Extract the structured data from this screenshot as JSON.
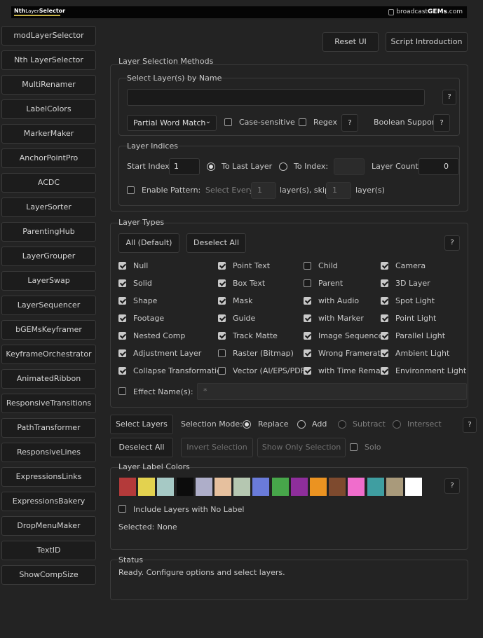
{
  "header": {
    "logo_main": "Nth",
    "logo_layer": "Layer",
    "logo_sel": "Selector",
    "brand_pre": "broadcast",
    "brand_gems": "GEMs",
    "brand_post": ".com"
  },
  "sidebar": {
    "items": [
      "modLayerSelector",
      "Nth LayerSelector",
      "MultiRenamer",
      "LabelColors",
      "MarkerMaker",
      "AnchorPointPro",
      "ACDC",
      "LayerSorter",
      "ParentingHub",
      "LayerGrouper",
      "LayerSwap",
      "LayerSequencer",
      "bGEMsKeyframer",
      "KeyframeOrchestrator",
      "AnimatedRibbon",
      "ResponsiveTransitions",
      "PathTransformer",
      "ResponsiveLines",
      "ExpressionsLinks",
      "ExpressionsBakery",
      "DropMenuMaker",
      "TextID",
      "ShowCompSize"
    ]
  },
  "top": {
    "reset": "Reset UI",
    "intro": "Script Introduction"
  },
  "methods": {
    "title": "Layer Selection Methods",
    "by_name": {
      "title": "Select Layer(s) by Name",
      "value": "",
      "match": "Partial Word Match",
      "case": "Case-sensitive",
      "regex": "Regex",
      "bool": "Boolean Support",
      "help": "?"
    },
    "indices": {
      "title": "Layer Indices",
      "start_label": "Start Index:",
      "start_value": "1",
      "to_last": "To Last Layer",
      "to_index": "To Index:",
      "count_label": "Layer Count:",
      "count_value": "0",
      "pattern": "Enable Pattern:",
      "every": "Select Every",
      "every_val": "1",
      "skip_label": "layer(s), skip",
      "skip_val": "1",
      "tail": "layer(s)"
    }
  },
  "types": {
    "title": "Layer Types",
    "all": "All (Default)",
    "deselect": "Deselect All",
    "help": "?",
    "col1": [
      {
        "label": "Null",
        "checked": true
      },
      {
        "label": "Solid",
        "checked": true
      },
      {
        "label": "Shape",
        "checked": true
      },
      {
        "label": "Footage",
        "checked": true
      },
      {
        "label": "Nested Comp",
        "checked": true
      },
      {
        "label": "Adjustment Layer",
        "checked": true
      },
      {
        "label": "Collapse Transformation",
        "checked": true
      }
    ],
    "col2": [
      {
        "label": "Point Text",
        "checked": true
      },
      {
        "label": "Box Text",
        "checked": true
      },
      {
        "label": "Mask",
        "checked": true
      },
      {
        "label": "Guide",
        "checked": true
      },
      {
        "label": "Track Matte",
        "checked": true
      },
      {
        "label": "Raster (Bitmap)",
        "checked": false
      },
      {
        "label": "Vector (AI/EPS/PDF)",
        "checked": false
      }
    ],
    "col3": [
      {
        "label": "Child",
        "checked": false
      },
      {
        "label": "Parent",
        "checked": false
      },
      {
        "label": "with Audio",
        "checked": true
      },
      {
        "label": "with Marker",
        "checked": true
      },
      {
        "label": "Image Sequence",
        "checked": true
      },
      {
        "label": "Wrong Framerate",
        "checked": true
      },
      {
        "label": "with Time Remap",
        "checked": true
      }
    ],
    "col4": [
      {
        "label": "Camera",
        "checked": true
      },
      {
        "label": "3D Layer",
        "checked": true
      },
      {
        "label": "Spot Light",
        "checked": true
      },
      {
        "label": "Point Light",
        "checked": true
      },
      {
        "label": "Parallel Light",
        "checked": true
      },
      {
        "label": "Ambient Light",
        "checked": true
      },
      {
        "label": "Environment Light",
        "checked": true
      }
    ],
    "effect_label": "Effect Name(s):",
    "effect_placeholder": "*"
  },
  "actions": {
    "select": "Select Layers",
    "mode_label": "Selection Mode:",
    "replace": "Replace",
    "add": "Add",
    "subtract": "Subtract",
    "intersect": "Intersect",
    "deselect": "Deselect All",
    "invert": "Invert Selection",
    "show_only": "Show Only Selection",
    "solo": "Solo",
    "help": "?"
  },
  "labels": {
    "title": "Layer Label Colors",
    "colors": [
      "#b43a3a",
      "#e3d24f",
      "#a6c9c5",
      "#0c0c0c",
      "#aeaec9",
      "#e6c09e",
      "#b5c7b1",
      "#6a7bd9",
      "#47a64a",
      "#8e2e9b",
      "#eb9321",
      "#7e4a2e",
      "#f06dcc",
      "#3f9ea1",
      "#a99a7b",
      "#ffffff"
    ],
    "include": "Include Layers with No Label",
    "selected": "Selected: None",
    "help": "?"
  },
  "status": {
    "title": "Status",
    "text": "Ready. Configure options and select layers."
  }
}
